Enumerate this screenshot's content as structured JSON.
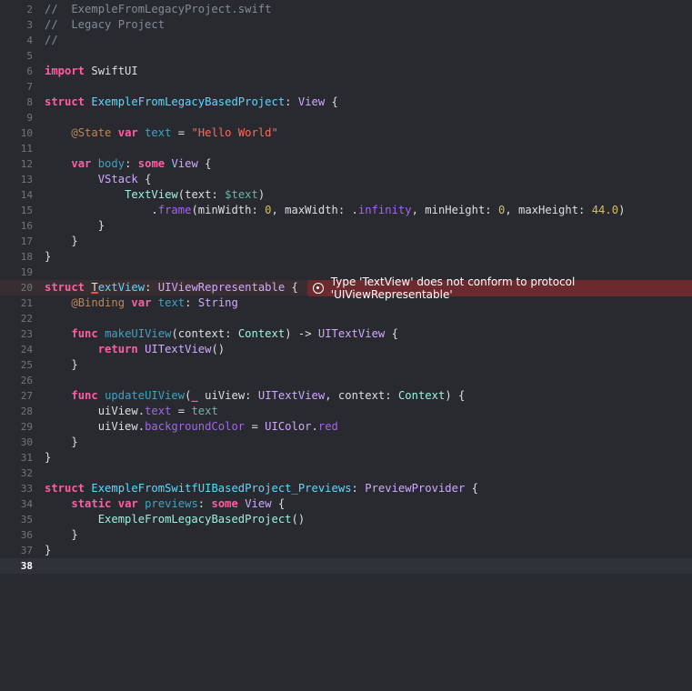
{
  "editor": {
    "current_line": "38",
    "error_line": "20",
    "lines": [
      {
        "n": "2",
        "tokens": [
          [
            "comment",
            "//  ExempleFromLegacyProject.swift"
          ]
        ]
      },
      {
        "n": "3",
        "tokens": [
          [
            "comment",
            "//  Legacy Project"
          ]
        ]
      },
      {
        "n": "4",
        "tokens": [
          [
            "comment",
            "//"
          ]
        ]
      },
      {
        "n": "5",
        "tokens": []
      },
      {
        "n": "6",
        "tokens": [
          [
            "keyword",
            "import"
          ],
          [
            "plain",
            " SwiftUI"
          ]
        ]
      },
      {
        "n": "7",
        "tokens": []
      },
      {
        "n": "8",
        "tokens": [
          [
            "keyword",
            "struct"
          ],
          [
            "plain",
            " "
          ],
          [
            "type",
            "ExempleFromLegacyBasedProject"
          ],
          [
            "plain",
            ": "
          ],
          [
            "typesys",
            "View"
          ],
          [
            "plain",
            " {"
          ]
        ]
      },
      {
        "n": "9",
        "tokens": []
      },
      {
        "n": "10",
        "tokens": [
          [
            "plain",
            "    "
          ],
          [
            "attr",
            "@State"
          ],
          [
            "plain",
            " "
          ],
          [
            "keyword",
            "var"
          ],
          [
            "plain",
            " "
          ],
          [
            "func",
            "text"
          ],
          [
            "plain",
            " = "
          ],
          [
            "string",
            "\"Hello World\""
          ]
        ]
      },
      {
        "n": "11",
        "tokens": []
      },
      {
        "n": "12",
        "tokens": [
          [
            "plain",
            "    "
          ],
          [
            "keyword",
            "var"
          ],
          [
            "plain",
            " "
          ],
          [
            "func",
            "body"
          ],
          [
            "plain",
            ": "
          ],
          [
            "keyword",
            "some"
          ],
          [
            "plain",
            " "
          ],
          [
            "typesys",
            "View"
          ],
          [
            "plain",
            " {"
          ]
        ]
      },
      {
        "n": "13",
        "tokens": [
          [
            "plain",
            "        "
          ],
          [
            "typesys",
            "VStack"
          ],
          [
            "plain",
            " {"
          ]
        ]
      },
      {
        "n": "14",
        "tokens": [
          [
            "plain",
            "            "
          ],
          [
            "typeproj",
            "TextView"
          ],
          [
            "plain",
            "(text: "
          ],
          [
            "var",
            "$text"
          ],
          [
            "plain",
            ")"
          ]
        ]
      },
      {
        "n": "15",
        "tokens": [
          [
            "plain",
            "                ."
          ],
          [
            "method",
            "frame"
          ],
          [
            "plain",
            "(minWidth: "
          ],
          [
            "number",
            "0"
          ],
          [
            "plain",
            ", maxWidth: ."
          ],
          [
            "method",
            "infinity"
          ],
          [
            "plain",
            ", minHeight: "
          ],
          [
            "number",
            "0"
          ],
          [
            "plain",
            ", maxHeight: "
          ],
          [
            "number",
            "44.0"
          ],
          [
            "plain",
            ")"
          ]
        ]
      },
      {
        "n": "16",
        "tokens": [
          [
            "plain",
            "        }"
          ]
        ]
      },
      {
        "n": "17",
        "tokens": [
          [
            "plain",
            "    }"
          ]
        ]
      },
      {
        "n": "18",
        "tokens": [
          [
            "plain",
            "}"
          ]
        ]
      },
      {
        "n": "19",
        "tokens": []
      },
      {
        "n": "20",
        "tokens": [
          [
            "keyword",
            "struct"
          ],
          [
            "plain",
            " "
          ],
          [
            "err",
            "T"
          ],
          [
            "type",
            "extView"
          ],
          [
            "plain",
            ": "
          ],
          [
            "typesys",
            "UIViewRepresentable"
          ],
          [
            "plain",
            " {"
          ]
        ]
      },
      {
        "n": "21",
        "tokens": [
          [
            "plain",
            "    "
          ],
          [
            "attr",
            "@Binding"
          ],
          [
            "plain",
            " "
          ],
          [
            "keyword",
            "var"
          ],
          [
            "plain",
            " "
          ],
          [
            "func",
            "text"
          ],
          [
            "plain",
            ": "
          ],
          [
            "typesys",
            "String"
          ]
        ]
      },
      {
        "n": "22",
        "tokens": []
      },
      {
        "n": "23",
        "tokens": [
          [
            "plain",
            "    "
          ],
          [
            "keyword",
            "func"
          ],
          [
            "plain",
            " "
          ],
          [
            "func",
            "makeUIView"
          ],
          [
            "plain",
            "(context: "
          ],
          [
            "typeproj",
            "Context"
          ],
          [
            "plain",
            ") -> "
          ],
          [
            "typesys",
            "UITextView"
          ],
          [
            "plain",
            " {"
          ]
        ]
      },
      {
        "n": "24",
        "tokens": [
          [
            "plain",
            "        "
          ],
          [
            "keyword",
            "return"
          ],
          [
            "plain",
            " "
          ],
          [
            "typesys",
            "UITextView"
          ],
          [
            "plain",
            "()"
          ]
        ]
      },
      {
        "n": "25",
        "tokens": [
          [
            "plain",
            "    }"
          ]
        ]
      },
      {
        "n": "26",
        "tokens": []
      },
      {
        "n": "27",
        "tokens": [
          [
            "plain",
            "    "
          ],
          [
            "keyword",
            "func"
          ],
          [
            "plain",
            " "
          ],
          [
            "func",
            "updateUIView"
          ],
          [
            "plain",
            "("
          ],
          [
            "keyword",
            "_"
          ],
          [
            "plain",
            " uiView: "
          ],
          [
            "typesys",
            "UITextView"
          ],
          [
            "plain",
            ", context: "
          ],
          [
            "typeproj",
            "Context"
          ],
          [
            "plain",
            ") {"
          ]
        ]
      },
      {
        "n": "28",
        "tokens": [
          [
            "plain",
            "        uiView."
          ],
          [
            "method",
            "text"
          ],
          [
            "plain",
            " = "
          ],
          [
            "var",
            "text"
          ]
        ]
      },
      {
        "n": "29",
        "tokens": [
          [
            "plain",
            "        uiView."
          ],
          [
            "method",
            "backgroundColor"
          ],
          [
            "plain",
            " = "
          ],
          [
            "typesys",
            "UIColor"
          ],
          [
            "plain",
            "."
          ],
          [
            "method",
            "red"
          ]
        ]
      },
      {
        "n": "30",
        "tokens": [
          [
            "plain",
            "    }"
          ]
        ]
      },
      {
        "n": "31",
        "tokens": [
          [
            "plain",
            "}"
          ]
        ]
      },
      {
        "n": "32",
        "tokens": []
      },
      {
        "n": "33",
        "tokens": [
          [
            "keyword",
            "struct"
          ],
          [
            "plain",
            " "
          ],
          [
            "type",
            "ExempleFromSwitfUIBasedProject_Previews"
          ],
          [
            "plain",
            ": "
          ],
          [
            "typesys",
            "PreviewProvider"
          ],
          [
            "plain",
            " {"
          ]
        ]
      },
      {
        "n": "34",
        "tokens": [
          [
            "plain",
            "    "
          ],
          [
            "keyword",
            "static"
          ],
          [
            "plain",
            " "
          ],
          [
            "keyword",
            "var"
          ],
          [
            "plain",
            " "
          ],
          [
            "func",
            "previews"
          ],
          [
            "plain",
            ": "
          ],
          [
            "keyword",
            "some"
          ],
          [
            "plain",
            " "
          ],
          [
            "typesys",
            "View"
          ],
          [
            "plain",
            " {"
          ]
        ]
      },
      {
        "n": "35",
        "tokens": [
          [
            "plain",
            "        "
          ],
          [
            "typeproj",
            "ExempleFromLegacyBasedProject"
          ],
          [
            "plain",
            "()"
          ]
        ]
      },
      {
        "n": "36",
        "tokens": [
          [
            "plain",
            "    }"
          ]
        ]
      },
      {
        "n": "37",
        "tokens": [
          [
            "plain",
            "}"
          ]
        ]
      },
      {
        "n": "38",
        "tokens": []
      }
    ]
  },
  "error_banner": {
    "icon": "error-circle-icon",
    "message": "Type 'TextView' does not conform to protocol 'UIViewRepresentable'"
  }
}
